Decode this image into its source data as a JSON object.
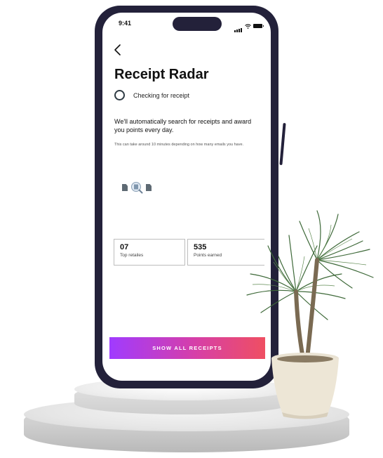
{
  "status_bar": {
    "time": "9:41"
  },
  "header": {
    "title": "Receipt Radar"
  },
  "status": {
    "text": "Checking for receipt"
  },
  "description": "We'll automatically search for receipts and award you points every day.",
  "note": "This can take around 10 minutes depending on how many emails you have.",
  "stats": [
    {
      "value": "07",
      "label": "Top  retailes"
    },
    {
      "value": "535",
      "label": "Points earned"
    }
  ],
  "cta": {
    "label": "SHOW ALL RECEIPTS"
  },
  "colors": {
    "phone_frame": "#23213a",
    "cta_gradient_start": "#a03bff",
    "cta_gradient_end": "#ef4f62",
    "status_ring": "#2f3b44"
  },
  "icons": [
    "back-arrow-icon",
    "signal-icon",
    "wifi-icon",
    "battery-icon",
    "checking-ring-icon",
    "document-icon",
    "magnifier-icon"
  ]
}
